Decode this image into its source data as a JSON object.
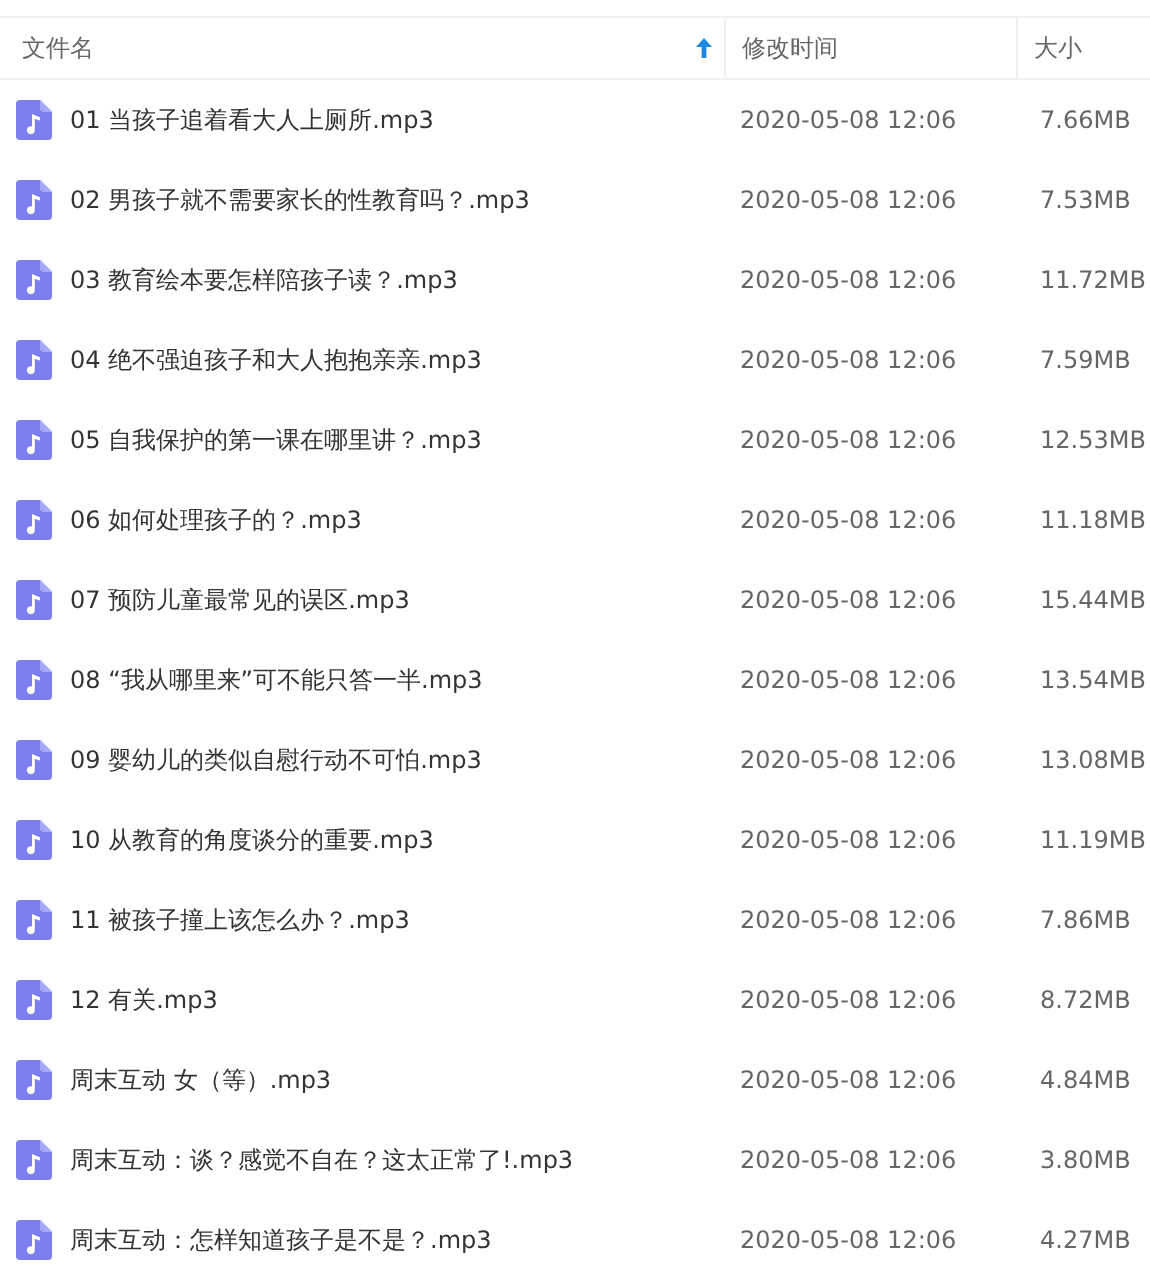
{
  "columns": [
    {
      "label": "文件名",
      "sorted": true
    },
    {
      "label": "修改时间",
      "sorted": false
    },
    {
      "label": "大小",
      "sorted": false
    }
  ],
  "files": [
    {
      "name": "01 当孩子追着看大人上厕所.mp3",
      "modified": "2020-05-08 12:06",
      "size": "7.66MB"
    },
    {
      "name": "02 男孩子就不需要家长的性教育吗？.mp3",
      "modified": "2020-05-08 12:06",
      "size": "7.53MB"
    },
    {
      "name": "03 教育绘本要怎样陪孩子读？.mp3",
      "modified": "2020-05-08 12:06",
      "size": "11.72MB"
    },
    {
      "name": "04 绝不强迫孩子和大人抱抱亲亲.mp3",
      "modified": "2020-05-08 12:06",
      "size": "7.59MB"
    },
    {
      "name": "05 自我保护的第一课在哪里讲？.mp3",
      "modified": "2020-05-08 12:06",
      "size": "12.53MB"
    },
    {
      "name": "06 如何处理孩子的？.mp3",
      "modified": "2020-05-08 12:06",
      "size": "11.18MB"
    },
    {
      "name": "07 预防儿童最常见的误区.mp3",
      "modified": "2020-05-08 12:06",
      "size": "15.44MB"
    },
    {
      "name": "08 “我从哪里来”可不能只答一半.mp3",
      "modified": "2020-05-08 12:06",
      "size": "13.54MB"
    },
    {
      "name": "09 婴幼儿的类似自慰行动不可怕.mp3",
      "modified": "2020-05-08 12:06",
      "size": "13.08MB"
    },
    {
      "name": "10 从教育的角度谈分的重要.mp3",
      "modified": "2020-05-08 12:06",
      "size": "11.19MB"
    },
    {
      "name": "11 被孩子撞上该怎么办？.mp3",
      "modified": "2020-05-08 12:06",
      "size": "7.86MB"
    },
    {
      "name": "12 有关.mp3",
      "modified": "2020-05-08 12:06",
      "size": "8.72MB"
    },
    {
      "name": "周末互动 女（等）.mp3",
      "modified": "2020-05-08 12:06",
      "size": "4.84MB"
    },
    {
      "name": "周末互动：谈？感觉不自在？这太正常了!.mp3",
      "modified": "2020-05-08 12:06",
      "size": "3.80MB"
    },
    {
      "name": "周末互动：怎样知道孩子是不是？.mp3",
      "modified": "2020-05-08 12:06",
      "size": "4.27MB"
    }
  ]
}
